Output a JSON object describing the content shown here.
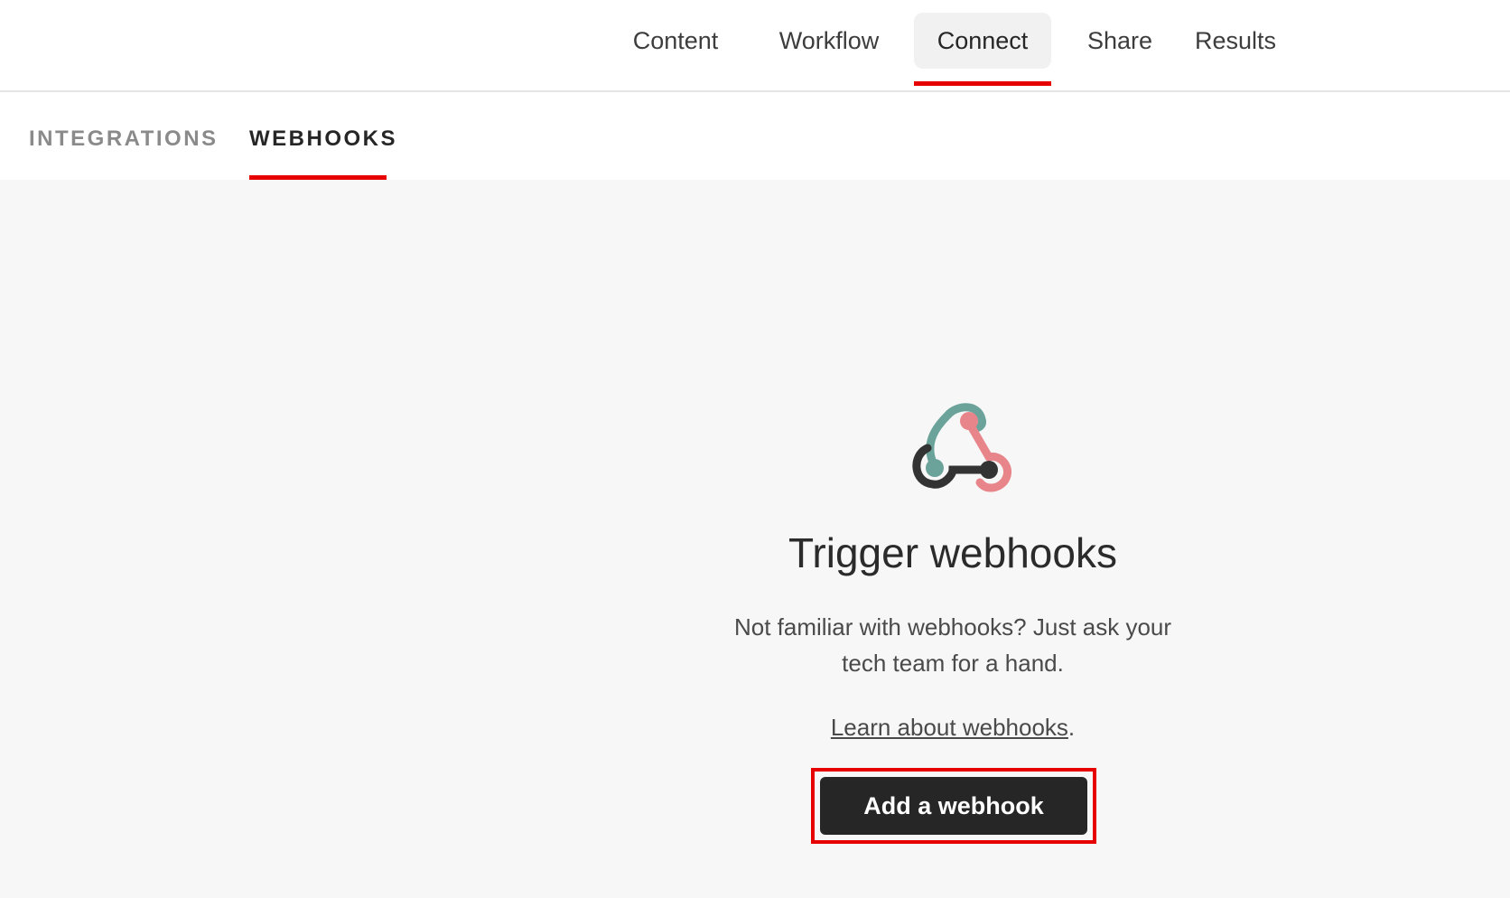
{
  "top_nav": {
    "tabs": [
      {
        "label": "Content"
      },
      {
        "label": "Workflow"
      },
      {
        "label": "Connect",
        "active": true
      },
      {
        "label": "Share"
      },
      {
        "label": "Results"
      }
    ]
  },
  "sub_nav": {
    "tabs": [
      {
        "label": "INTEGRATIONS"
      },
      {
        "label": "WEBHOOKS",
        "active": true
      }
    ]
  },
  "empty_state": {
    "icon": "webhook-icon",
    "title": "Trigger webhooks",
    "description": "Not familiar with webhooks? Just ask your tech team for a hand.",
    "learn_link": "Learn about webhooks",
    "learn_suffix": ".",
    "add_button": "Add a webhook"
  },
  "colors": {
    "accent": "#e60000",
    "button_bg": "#262626",
    "icon_teal": "#6ba39a",
    "icon_pink": "#e8858a",
    "icon_dark": "#333333"
  }
}
